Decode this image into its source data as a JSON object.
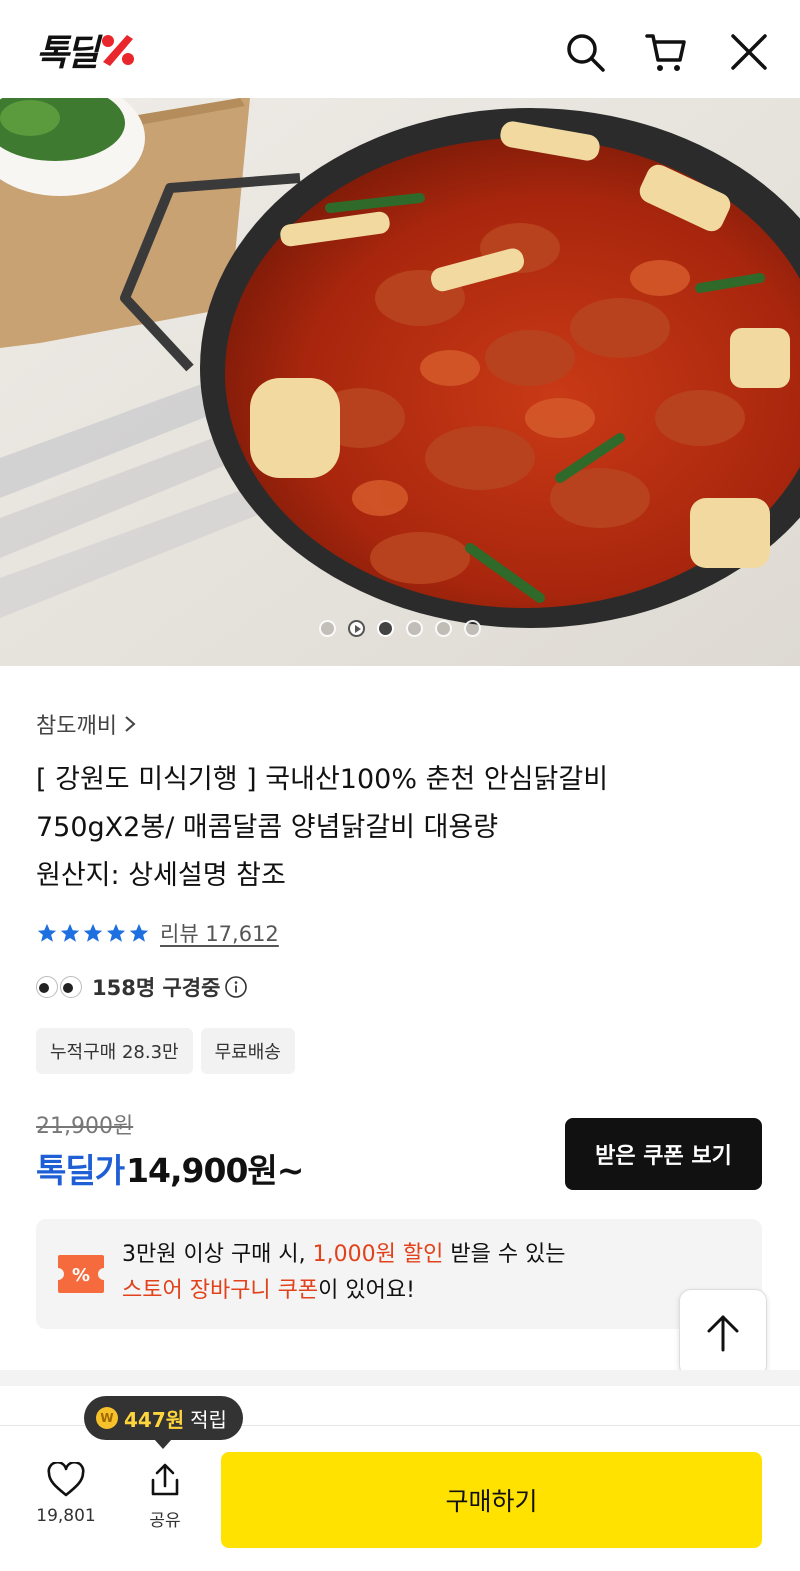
{
  "header": {
    "logo_text": "톡딜",
    "icons": [
      "search-icon",
      "cart-icon",
      "close-icon"
    ],
    "brand_color": "#e8262b"
  },
  "gallery": {
    "slide_count": 6,
    "active_index": 2
  },
  "product": {
    "seller": "참도깨비",
    "title_lines": [
      "[ 강원도 미식기행 ] 국내산100% 춘천 안심닭갈비",
      "750gX2봉/ 매콤달콤 양념닭갈비 대용량",
      "원산지: 상세설명 참조"
    ],
    "rating": 5,
    "review_label": "리뷰 17,612",
    "viewers_label": "158명 구경중",
    "tags": [
      "누적구매 28.3만",
      "무료배송"
    ],
    "original_price": "21,900원",
    "deal_label": "톡딜가",
    "deal_price": "14,900원~",
    "coupon_button": "받은 쿠폰 보기"
  },
  "promo": {
    "line1_a": "3만원 이상 구매 시, ",
    "line1_highlight": "1,000원 할인",
    "line1_b": " 받을 수 있는",
    "line2_highlight": "스토어 장바구니 쿠폰",
    "line2_b": "이 있어요!",
    "accent_color": "#e2421b"
  },
  "bottom_bar": {
    "like_count": "19,801",
    "share_label": "공유",
    "buy_label": "구매하기",
    "buy_color": "#ffe200",
    "reward_amount": "447원",
    "reward_label": "적립"
  }
}
